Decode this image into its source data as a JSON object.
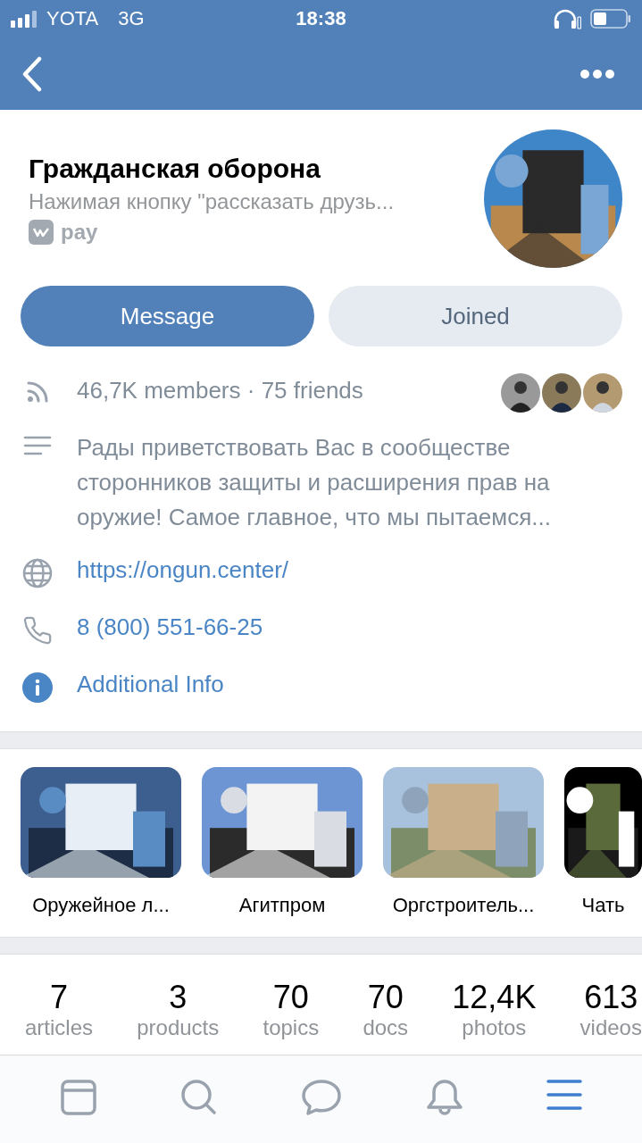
{
  "status_bar": {
    "carrier": "YOTA",
    "network": "3G",
    "time": "18:38"
  },
  "community": {
    "title": "Гражданская оборона",
    "subtitle": "Нажимая кнопку \"рассказать друзь...",
    "pay_label": "pay"
  },
  "buttons": [
    {
      "label": "Message",
      "kind": "primary"
    },
    {
      "label": "Joined",
      "kind": "secondary"
    }
  ],
  "info_rows": [
    {
      "kind": "members",
      "text": "46,7K members · 75 friends"
    },
    {
      "kind": "description",
      "text": "Рады приветствовать Вас в сообществе сторонников защиты и расширения прав на оружие! Самое главное, что мы пытаемся..."
    },
    {
      "kind": "website",
      "text": "https://ongun.center/"
    },
    {
      "kind": "phone",
      "text": "8 (800) 551-66-25"
    },
    {
      "kind": "info",
      "text": "Additional Info"
    }
  ],
  "albums": [
    {
      "label": "Оружейное л..."
    },
    {
      "label": "Агитпром"
    },
    {
      "label": "Оргстроитель..."
    },
    {
      "label": "Чать"
    }
  ],
  "stats": [
    {
      "value": "7",
      "label": "articles"
    },
    {
      "value": "3",
      "label": "products"
    },
    {
      "value": "70",
      "label": "topics"
    },
    {
      "value": "70",
      "label": "docs"
    },
    {
      "value": "12,4K",
      "label": "photos"
    },
    {
      "value": "613",
      "label": "videos"
    }
  ],
  "tabs": [
    {
      "kind": "feed",
      "selected": false
    },
    {
      "kind": "search",
      "selected": false
    },
    {
      "kind": "messages",
      "selected": false
    },
    {
      "kind": "notifications",
      "selected": false
    },
    {
      "kind": "menu",
      "selected": true
    }
  ]
}
